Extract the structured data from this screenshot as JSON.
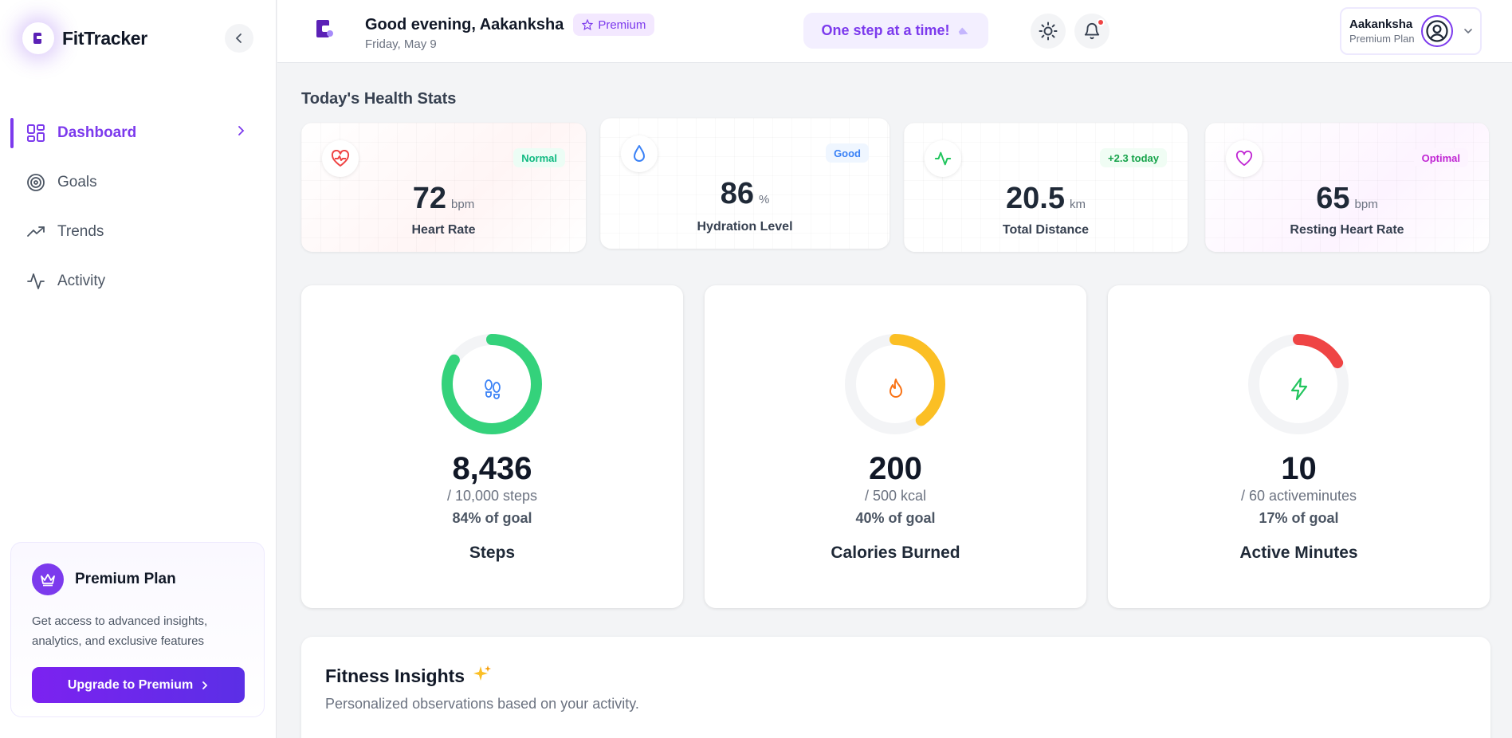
{
  "brand": {
    "name": "FitTracker"
  },
  "sidebar": {
    "items": [
      {
        "label": "Dashboard",
        "icon": "dashboard-grid-icon",
        "active": true
      },
      {
        "label": "Goals",
        "icon": "target-icon"
      },
      {
        "label": "Trends",
        "icon": "trending-up-icon"
      },
      {
        "label": "Activity",
        "icon": "activity-pulse-icon"
      }
    ],
    "premium": {
      "title": "Premium Plan",
      "description": "Get access to advanced insights, analytics, and exclusive features",
      "button": "Upgrade to Premium"
    }
  },
  "header": {
    "greeting": "Good evening, Aakanksha",
    "badge": "Premium",
    "date": "Friday, May 9",
    "motto": "One step at a time!",
    "user": {
      "name": "Aakanksha",
      "plan": "Premium Plan"
    }
  },
  "stats": {
    "title": "Today's Health Stats",
    "cards": [
      {
        "value": "72",
        "unit": "bpm",
        "label": "Heart Rate",
        "badge": "Normal",
        "icon": "heart-pulse-icon",
        "color": "#ef4444"
      },
      {
        "value": "86",
        "unit": "%",
        "label": "Hydration Level",
        "badge": "Good",
        "icon": "droplet-icon",
        "color": "#3b82f6"
      },
      {
        "value": "20.5",
        "unit": "km",
        "label": "Total Distance",
        "badge": "+2.3 today",
        "icon": "activity-icon",
        "color": "#22c55e"
      },
      {
        "value": "65",
        "unit": "bpm",
        "label": "Resting Heart Rate",
        "badge": "Optimal",
        "icon": "heart-icon",
        "color": "#c026d3"
      }
    ]
  },
  "goals": [
    {
      "value": "8,436",
      "target": "/ 10,000 steps",
      "percent_text": "84% of goal",
      "label": "Steps",
      "progress": 0.84,
      "color": "#34d27b",
      "icon": "footprints-icon"
    },
    {
      "value": "200",
      "target": "/ 500 kcal",
      "percent_text": "40% of goal",
      "label": "Calories Burned",
      "progress": 0.4,
      "color": "#fbbf24",
      "icon": "flame-icon"
    },
    {
      "value": "10",
      "target": "/ 60 activeminutes",
      "percent_text": "17% of goal",
      "label": "Active Minutes",
      "progress": 0.17,
      "color": "#ef4444",
      "icon": "lightning-icon"
    }
  ],
  "insights": {
    "title": "Fitness Insights",
    "subtitle": "Personalized observations based on your activity."
  },
  "colors": {
    "accent": "#7c3aed",
    "background": "#f3f4f6"
  }
}
